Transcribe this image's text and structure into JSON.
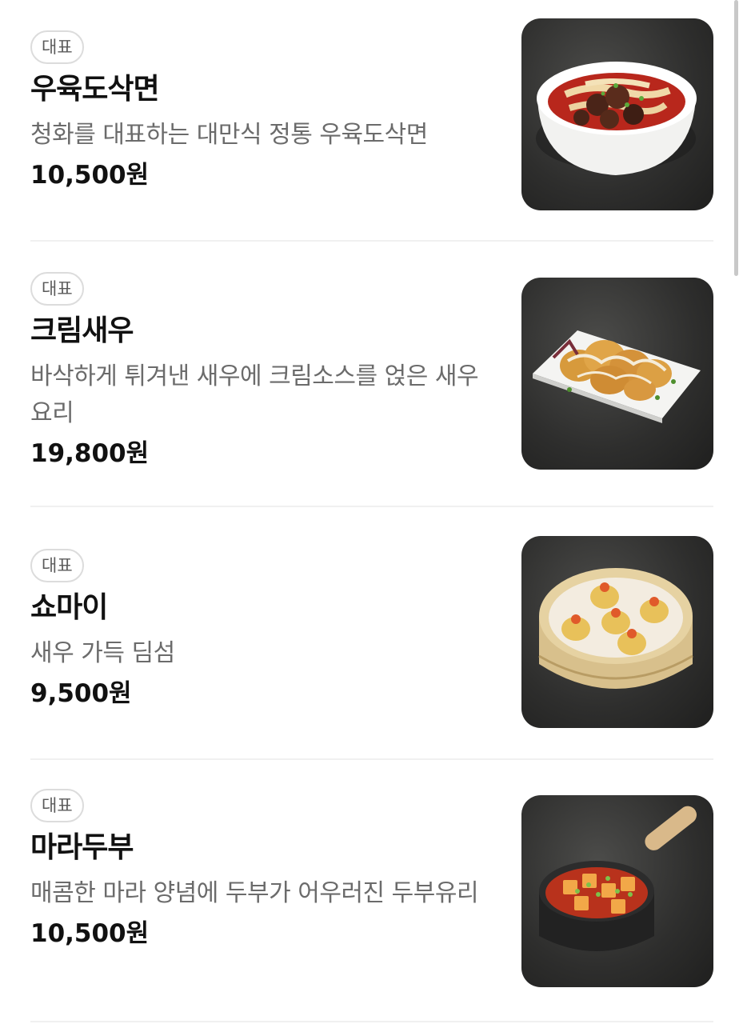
{
  "menu": {
    "items": [
      {
        "badge": "대표",
        "name": "우육도삭면",
        "description": "청화를 대표하는 대만식 정통 우육도삭면",
        "price": "10,500원",
        "image_icon": "beef-noodle-soup-photo"
      },
      {
        "badge": "대표",
        "name": "크림새우",
        "description": "바삭하게 튀겨낸 새우에 크림소스를 얹은 새우요리",
        "price": "19,800원",
        "image_icon": "cream-shrimp-photo"
      },
      {
        "badge": "대표",
        "name": "쇼마이",
        "description": "새우 가득 딤섬",
        "price": "9,500원",
        "image_icon": "shumai-dimsum-photo"
      },
      {
        "badge": "대표",
        "name": "마라두부",
        "description": "매콤한 마라 양념에 두부가 어우러진 두부유리",
        "price": "10,500원",
        "image_icon": "mala-tofu-photo"
      }
    ]
  }
}
